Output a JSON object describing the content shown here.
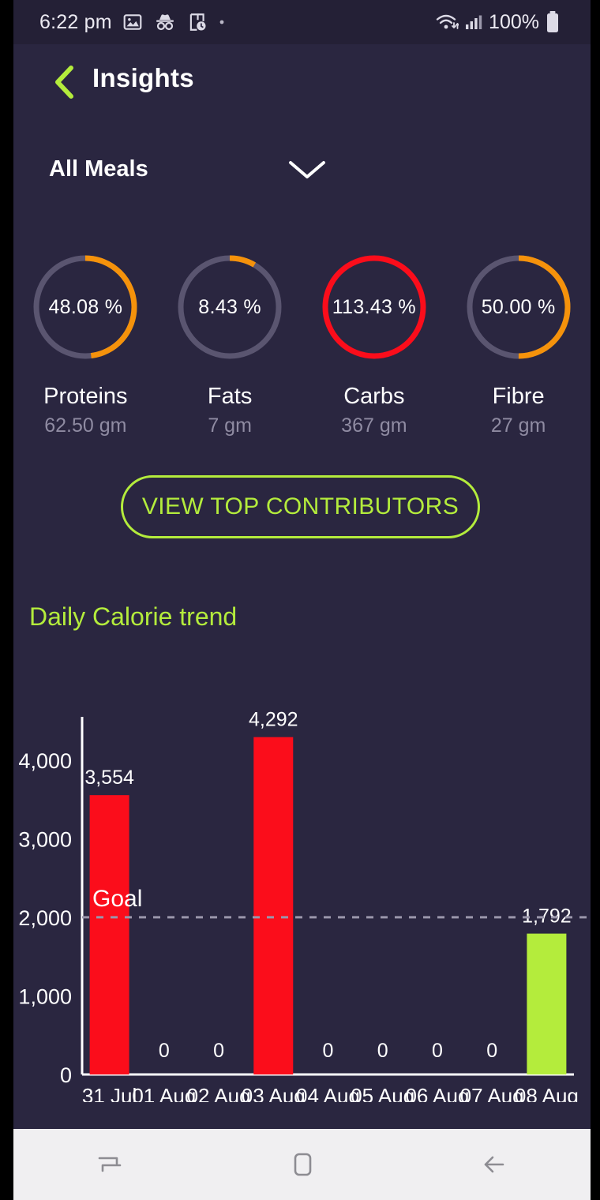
{
  "status_bar": {
    "time": "6:22 pm",
    "battery_text": "100%",
    "icons": [
      "image-icon",
      "incognito-icon",
      "document-clock-icon",
      "dot-icon",
      "wifi-icon",
      "cellular-signal-icon",
      "battery-icon"
    ]
  },
  "header": {
    "back_icon": "chevron-left-icon",
    "title": "Insights"
  },
  "meal_selector": {
    "label": "All Meals",
    "chevron_icon": "chevron-down-icon"
  },
  "nutrients": [
    {
      "name": "Proteins",
      "percent_label": "48.08 %",
      "percent": 48.08,
      "grams": "62.50 gm",
      "color": "#f5920b"
    },
    {
      "name": "Fats",
      "percent_label": "8.43 %",
      "percent": 8.43,
      "grams": "7 gm",
      "color": "#f5920b"
    },
    {
      "name": "Carbs",
      "percent_label": "113.43 %",
      "percent": 113.43,
      "grams": "367 gm",
      "color": "#fb0d1b"
    },
    {
      "name": "Fibre",
      "percent_label": "50.00 %",
      "percent": 50.0,
      "grams": "27 gm",
      "color": "#f5920b"
    }
  ],
  "donut_track_color": "#5a5570",
  "contributors_button": {
    "label": "VIEW TOP CONTRIBUTORS",
    "accent": "#b4ec3c"
  },
  "chart_title": "Daily Calorie trend",
  "nav_bar": {
    "items": [
      {
        "name": "recents-icon",
        "label": "Recents"
      },
      {
        "name": "home-icon",
        "label": "Home"
      },
      {
        "name": "back-arrow-icon",
        "label": "Back"
      }
    ]
  },
  "chart_data": {
    "type": "bar",
    "title": "Daily Calorie trend",
    "xlabel": "",
    "ylabel": "",
    "categories": [
      "31 Jul",
      "01 Aug",
      "02 Aug",
      "03 Aug",
      "04 Aug",
      "05 Aug",
      "06 Aug",
      "07 Aug",
      "08 Aug"
    ],
    "values": [
      3554,
      0,
      0,
      4292,
      0,
      0,
      0,
      0,
      1792
    ],
    "value_labels": [
      "3,554",
      "0",
      "0",
      "4,292",
      "0",
      "0",
      "0",
      "0",
      "1,792"
    ],
    "bar_colors": [
      "#fb0d1b",
      "#fb0d1b",
      "#fb0d1b",
      "#fb0d1b",
      "#fb0d1b",
      "#fb0d1b",
      "#fb0d1b",
      "#fb0d1b",
      "#b4ec3c"
    ],
    "ytick_labels": [
      "0",
      "1,000",
      "2,000",
      "3,000",
      "4,000"
    ],
    "yticks": [
      0,
      1000,
      2000,
      3000,
      4000
    ],
    "ylim": [
      0,
      4550
    ],
    "grid": false,
    "goal": {
      "value": 2000,
      "label": "Goal",
      "line_style": "dashed",
      "color": "#9a96ab"
    },
    "legend": null
  }
}
